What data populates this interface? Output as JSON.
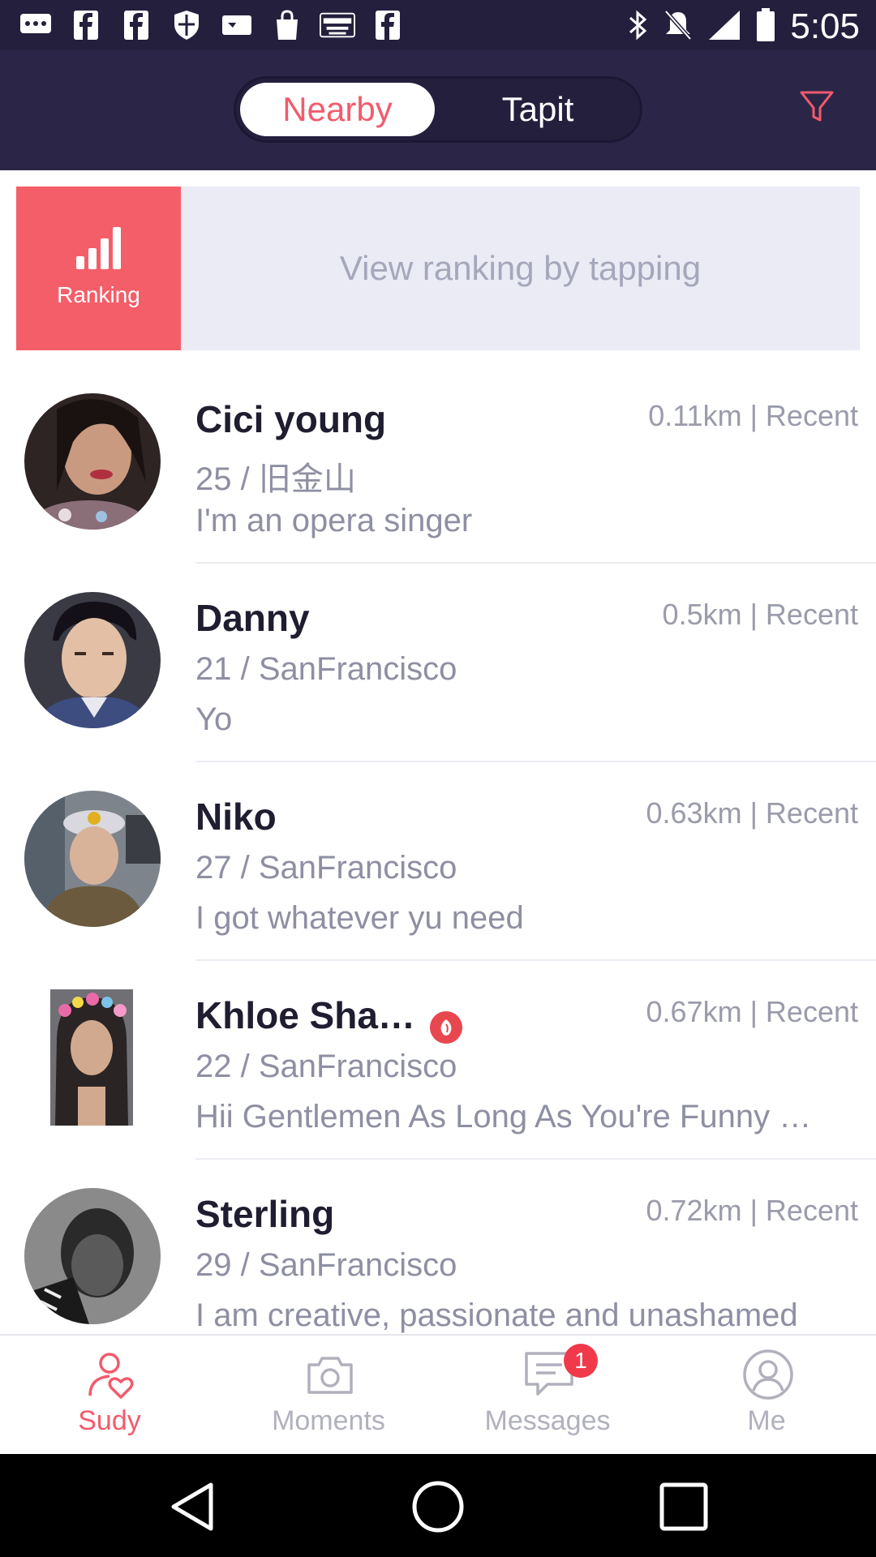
{
  "status_bar": {
    "time": "5:05",
    "icons": [
      "message-icon",
      "facebook-icon",
      "facebook-icon",
      "shield-icon",
      "tv-icon",
      "shopping-bag-icon",
      "espn-icon",
      "facebook-icon",
      "bluetooth-icon",
      "silent-icon",
      "signal-icon",
      "battery-icon"
    ]
  },
  "header": {
    "tabs": [
      {
        "label": "Nearby",
        "active": true
      },
      {
        "label": "Tapit",
        "active": false
      }
    ],
    "filter_icon": "filter-icon"
  },
  "ranking": {
    "label": "Ranking",
    "icon": "bar-chart-icon",
    "hint": "View ranking by tapping"
  },
  "people": [
    {
      "name": "Cici young",
      "distance": "0.11km | Recent",
      "info": "25 / 旧金山",
      "bio": "I'm an opera singer",
      "badge": false
    },
    {
      "name": "Danny",
      "distance": "0.5km | Recent",
      "info": "21 / SanFrancisco",
      "bio": "Yo",
      "badge": false
    },
    {
      "name": "Niko",
      "distance": "0.63km | Recent",
      "info": "27 / SanFrancisco",
      "bio": "I got whatever yu need",
      "badge": false
    },
    {
      "name": "Khloe Sha…",
      "distance": "0.67km | Recent",
      "info": "22 / SanFrancisco",
      "bio": "Hii Gentlemen As Long As You're Funny …",
      "badge": true
    },
    {
      "name": "Sterling",
      "distance": "0.72km | Recent",
      "info": "29 / SanFrancisco",
      "bio": "I am creative, passionate and unashamed",
      "badge": false
    }
  ],
  "tabbar": {
    "tabs": [
      {
        "label": "Sudy",
        "icon": "heart-person-icon",
        "active": true
      },
      {
        "label": "Moments",
        "icon": "camera-icon",
        "active": false
      },
      {
        "label": "Messages",
        "icon": "chat-icon",
        "active": false,
        "badge": "1"
      },
      {
        "label": "Me",
        "icon": "user-icon",
        "active": false
      }
    ]
  },
  "colors": {
    "accent": "#f25b6c",
    "header_bg": "#2b2647",
    "ranking_bg": "#ebebf5"
  }
}
